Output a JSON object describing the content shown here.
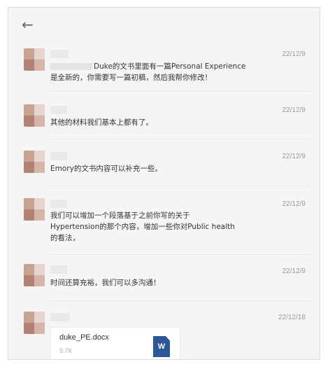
{
  "header": {
    "back_icon": "←"
  },
  "messages": [
    {
      "date": "22/12/9",
      "text": "Duke的文书里面有一篇Personal Experience\n是全新的，你需要写一篇初稿，然后我帮你修改！"
    },
    {
      "date": "22/12/9",
      "text": "其他的材料我们基本上都有了。"
    },
    {
      "date": "22/12/9",
      "text": "Emory的文书内容可以补充一些。"
    },
    {
      "date": "22/12/9",
      "text": "我们可以增加一个段落基于之前你写的关于\nHypertension的那个内容，增加一些你对Public health\n的看法，"
    },
    {
      "date": "22/12/9",
      "text": "时间还算充裕，我们可以多沟通！"
    },
    {
      "date": "22/12/18",
      "file": {
        "name": "duke_PE.docx",
        "size": "9.7K",
        "icon_letter": "W"
      }
    }
  ],
  "colors": {
    "background": "#f5f5f5",
    "text": "#333333",
    "date": "#9a9a9a",
    "word_blue": "#2b5797"
  }
}
